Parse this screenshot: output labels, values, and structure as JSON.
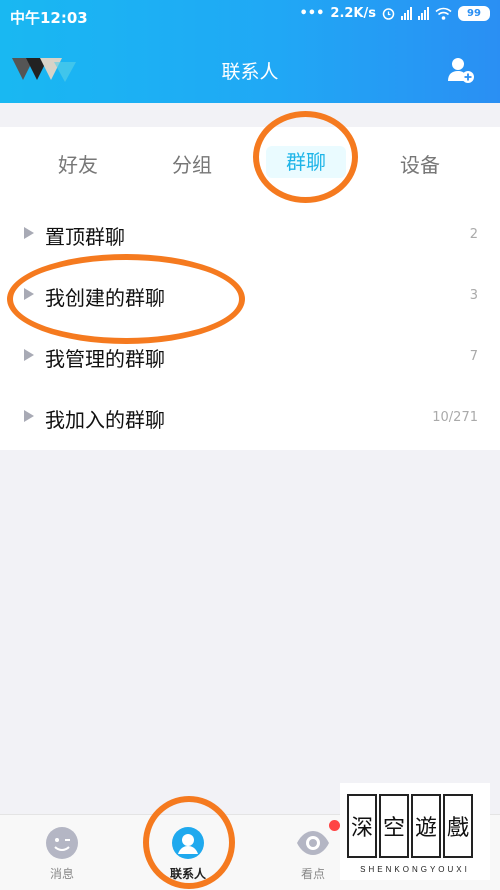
{
  "status_bar": {
    "time": "中午12:03",
    "net_speed": "2.2K/s",
    "battery": "99"
  },
  "header": {
    "title": "联系人",
    "icons": {
      "logo": "app-logo",
      "add_friend": "add-contact-icon"
    }
  },
  "tabs": [
    {
      "label": "好友",
      "active": false
    },
    {
      "label": "分组",
      "active": false
    },
    {
      "label": "群聊",
      "active": true
    },
    {
      "label": "设备",
      "active": false
    }
  ],
  "groups": [
    {
      "label": "置顶群聊",
      "count": "2"
    },
    {
      "label": "我创建的群聊",
      "count": "3"
    },
    {
      "label": "我管理的群聊",
      "count": "7"
    },
    {
      "label": "我加入的群聊",
      "count": "10/271"
    }
  ],
  "bottom_nav": [
    {
      "label": "消息",
      "icon": "message-icon",
      "active": false
    },
    {
      "label": "联系人",
      "icon": "contacts-icon",
      "active": true
    },
    {
      "label": "看点",
      "icon": "eye-icon",
      "active": false
    }
  ],
  "watermark": {
    "chars": [
      "深",
      "空",
      "遊",
      "戲"
    ],
    "subtitle": "SHENKONGYOUXI"
  },
  "colors": {
    "header_start": "#19b8f2",
    "header_end": "#2a8ff3",
    "accent": "#1fb5e8",
    "annotation": "#f57a1f"
  }
}
